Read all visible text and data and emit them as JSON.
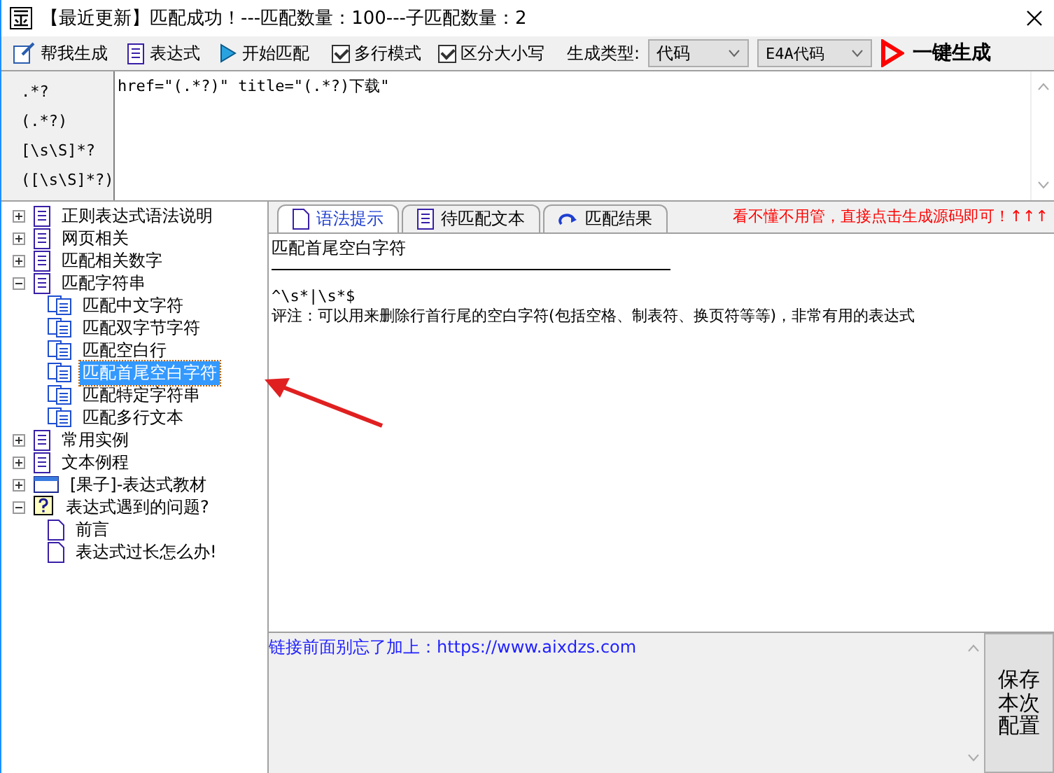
{
  "window": {
    "title": "【最近更新】匹配成功！---匹配数量：100---子匹配数量：2"
  },
  "toolbar": {
    "buttons": [
      {
        "label": "帮我生成",
        "kind": "wand"
      },
      {
        "label": "表达式",
        "kind": "doc"
      },
      {
        "label": "开始匹配",
        "kind": "play"
      }
    ],
    "checkboxes": [
      {
        "label": "多行模式",
        "checked": true
      },
      {
        "label": "区分大小写",
        "checked": true
      }
    ],
    "type_label": "生成类型:",
    "dropdowns": [
      {
        "value": "代码"
      },
      {
        "value": "E4A代码"
      }
    ],
    "generate_button": "一键生成"
  },
  "snippets": [
    ".*?",
    "(.*?)",
    "[\\s\\S]*?",
    "([\\s\\S]*?)"
  ],
  "expression": "href=\"(.*?)\" title=\"(.*?)下载\"",
  "tree": [
    {
      "label": "正则表达式语法说明",
      "kind": "doc",
      "expanded": false,
      "selected": false
    },
    {
      "label": "网页相关",
      "kind": "doc",
      "expanded": false,
      "selected": false
    },
    {
      "label": "匹配相关数字",
      "kind": "doc",
      "expanded": false,
      "selected": false
    },
    {
      "label": "匹配字符串",
      "kind": "doc",
      "expanded": true,
      "selected": false,
      "children": [
        {
          "label": "匹配中文字符",
          "kind": "pages",
          "selected": false
        },
        {
          "label": "匹配双字节字符",
          "kind": "pages",
          "selected": false
        },
        {
          "label": "匹配空白行",
          "kind": "pages",
          "selected": false
        },
        {
          "label": "匹配首尾空白字符",
          "kind": "pages",
          "selected": true
        },
        {
          "label": "匹配特定字符串",
          "kind": "pages",
          "selected": false
        },
        {
          "label": "匹配多行文本",
          "kind": "pages",
          "selected": false
        }
      ]
    },
    {
      "label": "常用实例",
      "kind": "doc",
      "expanded": false,
      "selected": false
    },
    {
      "label": "文本例程",
      "kind": "doc",
      "expanded": false,
      "selected": false
    },
    {
      "label": "[果子]-表达式教材",
      "kind": "book",
      "expanded": false,
      "selected": false
    },
    {
      "label": "表达式遇到的问题?",
      "kind": "help",
      "expanded": true,
      "selected": false,
      "children": [
        {
          "label": "前言",
          "kind": "page",
          "selected": false
        },
        {
          "label": "表达式过长怎么办!",
          "kind": "page",
          "selected": false
        }
      ]
    }
  ],
  "tabs": [
    {
      "label": "语法提示",
      "kind": "page",
      "selected": true
    },
    {
      "label": "待匹配文本",
      "kind": "doc",
      "selected": false
    },
    {
      "label": "匹配结果",
      "kind": "redo",
      "selected": false
    }
  ],
  "tip": "看不懂不用管，直接点击生成源码即可！↑↑↑",
  "content": {
    "heading": "匹配首尾空白字符",
    "pattern": "^\\s*|\\s*$",
    "note": "评注：可以用来删除行首行尾的空白字符(包括空格、制表符、换页符等等)，非常有用的表达式"
  },
  "bottom": {
    "note": "链接前面别忘了加上：https://www.aixdzs.com",
    "save_button": "保存本次配置"
  }
}
